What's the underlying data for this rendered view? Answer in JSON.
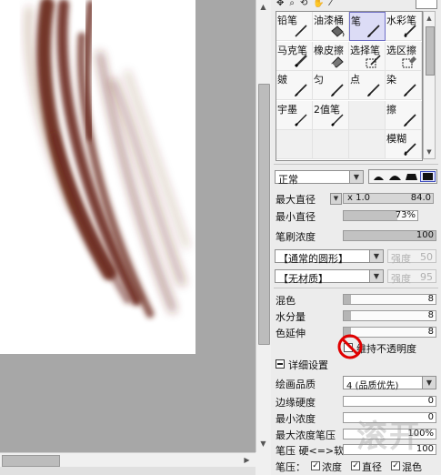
{
  "colors": {
    "stroke": "#6b2a1e",
    "panel_bg": "#ececec",
    "selection": "#dcdcf6",
    "canvas_bg": "#a7a7a7"
  },
  "top_tools": {
    "icons": [
      "move-icon",
      "zoom-icon",
      "rotate-icon",
      "hand-icon",
      "eyedropper-icon"
    ]
  },
  "tools": [
    {
      "name": "铅笔",
      "icon": "pencil-icon",
      "selected": false
    },
    {
      "name": "油漆桶",
      "icon": "bucket-icon",
      "selected": false
    },
    {
      "name": "笔",
      "icon": "brush-icon",
      "selected": true
    },
    {
      "name": "水彩笔",
      "icon": "watercolor-icon",
      "selected": false
    },
    {
      "name": "马克笔",
      "icon": "marker-icon",
      "selected": false
    },
    {
      "name": "橡皮擦",
      "icon": "eraser-icon",
      "selected": false
    },
    {
      "name": "选择笔",
      "icon": "selection-pen-icon",
      "selected": false
    },
    {
      "name": "选区擦",
      "icon": "selection-eraser-icon",
      "selected": false
    },
    {
      "name": "皴",
      "icon": "brush-icon",
      "selected": false
    },
    {
      "name": "匀",
      "icon": "brush-icon",
      "selected": false
    },
    {
      "name": "点",
      "icon": "brush-icon",
      "selected": false
    },
    {
      "name": "染",
      "icon": "brush-icon",
      "selected": false
    },
    {
      "name": "宇墨",
      "icon": "pen-icon",
      "selected": false
    },
    {
      "name": "2值笔",
      "icon": "pen-icon",
      "selected": false
    },
    {
      "name": "",
      "icon": "",
      "selected": false
    },
    {
      "name": "擦",
      "icon": "brush-icon",
      "selected": false
    },
    {
      "name": "",
      "icon": "",
      "selected": false
    },
    {
      "name": "",
      "icon": "",
      "selected": false
    },
    {
      "name": "",
      "icon": "",
      "selected": false
    },
    {
      "name": "模糊",
      "icon": "blur-icon",
      "selected": false
    }
  ],
  "blend_mode": "正常",
  "max_size": {
    "label": "最大直径",
    "multiplier": "x 1.0",
    "value": "84.0"
  },
  "min_size": {
    "label": "最小直径",
    "value": "73%",
    "fraction": 0.73
  },
  "density": {
    "label": "笔刷浓度",
    "value": "100",
    "fraction": 1.0
  },
  "shape_dropdown": {
    "value": "【通常的圆形】",
    "strength_label": "强度",
    "strength_value": "50"
  },
  "texture_dropdown": {
    "value": "【无材质】",
    "strength_label": "强度",
    "strength_value": "95"
  },
  "blending": {
    "label": "混色",
    "value": "8"
  },
  "dilution": {
    "label": "水分量",
    "value": "8"
  },
  "persistence": {
    "label": "色延伸",
    "value": "8"
  },
  "keep_opacity": {
    "label": "维持不透明度",
    "checked": false
  },
  "advanced": {
    "label": "详细设置"
  },
  "quality": {
    "label": "绘画品质",
    "value": "4 (品质优先)"
  },
  "edge_hardness": {
    "label": "边缘硬度",
    "value": "0"
  },
  "min_density": {
    "label": "最小浓度",
    "value": "0"
  },
  "max_density_pressure": {
    "label": "最大浓度笔压",
    "value": "100%"
  },
  "pressure_hardness": {
    "label": "笔压 硬<=>软",
    "value": "100"
  },
  "pressure": {
    "label": "笔压：",
    "density": "浓度",
    "size": "直径",
    "blend": "混色"
  },
  "watermark": "滚开"
}
